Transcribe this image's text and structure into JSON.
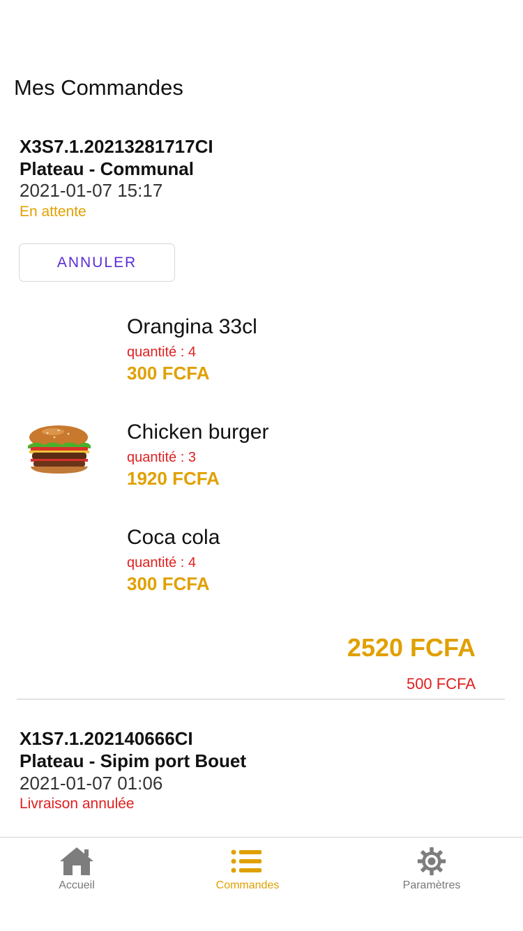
{
  "header": {
    "title": "Mes Commandes"
  },
  "orders": [
    {
      "id": "X3S7.1.20213281717CI",
      "place": "Plateau - Communal",
      "date": "2021-01-07 15:17",
      "status": "En attente",
      "cancel_label": "ANNULER",
      "items": [
        {
          "name": "Orangina 33cl",
          "quantity": "quantité : 4",
          "price": "300 FCFA",
          "icon": "none"
        },
        {
          "name": "Chicken burger",
          "quantity": "quantité : 3",
          "price": "1920 FCFA",
          "icon": "burger-image"
        },
        {
          "name": "Coca cola",
          "quantity": "quantité : 4",
          "price": "300 FCFA",
          "icon": "none"
        }
      ],
      "total": "2520 FCFA",
      "delivery_fee": "500 FCFA"
    },
    {
      "id": "X1S7.1.202140666CI",
      "place": "Plateau - Sipim port Bouet",
      "date": "2021-01-07 01:06",
      "status": "Livraison annulée"
    }
  ],
  "tabbar": {
    "tabs": [
      {
        "label": "Accueil",
        "icon": "home-icon"
      },
      {
        "label": "Commandes",
        "icon": "list-icon",
        "active": true
      },
      {
        "label": "Paramètres",
        "icon": "gear-icon"
      }
    ]
  },
  "colors": {
    "accent": "#e0a000",
    "danger": "#e02020",
    "button_text": "#5a2bd6"
  }
}
